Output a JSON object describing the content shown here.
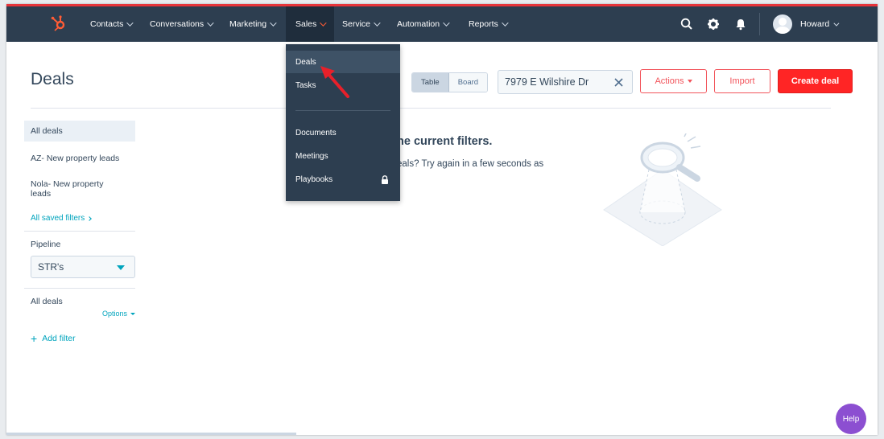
{
  "nav": {
    "items": [
      "Contacts",
      "Conversations",
      "Marketing",
      "Sales",
      "Service",
      "Automation",
      "Reports"
    ],
    "user": "Howard"
  },
  "page": {
    "title": "Deals",
    "view_table": "Table",
    "view_board": "Board",
    "search_value": "7979 E Wilshire Dr",
    "actions_label": "Actions",
    "import_label": "Import",
    "create_label": "Create deal"
  },
  "sidebar": {
    "views": [
      "All deals",
      "AZ- New property leads",
      "Nola- New property leads"
    ],
    "saved_filters": "All saved filters",
    "pipeline_label": "Pipeline",
    "pipeline_value": "STR's",
    "filter_title": "All deals",
    "options_label": "Options",
    "add_filter": "Add filter"
  },
  "empty_state": {
    "title": "ne current filters.",
    "text": "eals? Try again in a few seconds as"
  },
  "dropdown": {
    "items": [
      "Deals",
      "Tasks",
      "Documents",
      "Meetings",
      "Playbooks"
    ]
  },
  "help_label": "Help",
  "colors": {
    "nav_bg": "#2d3e50",
    "primary": "#ff2525",
    "accent": "#00a4bd",
    "help": "#8c4fd1"
  }
}
